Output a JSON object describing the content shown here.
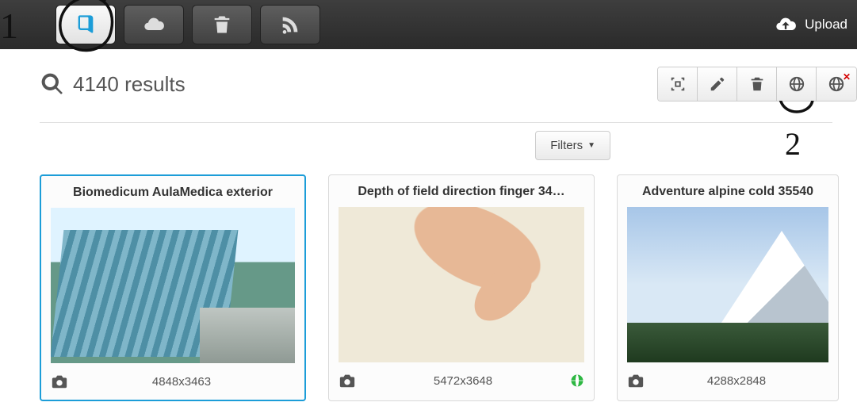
{
  "topbar": {
    "upload_label": "Upload"
  },
  "results": {
    "count_text": "4140 results"
  },
  "filters": {
    "label": "Filters"
  },
  "cards": [
    {
      "title": "Biomedicum AulaMedica exterior",
      "dims": "4848x3463",
      "public": false,
      "selected": true
    },
    {
      "title": "Depth of field direction finger 34…",
      "dims": "5472x3648",
      "public": true,
      "selected": false
    },
    {
      "title": "Adventure alpine cold 35540",
      "dims": "4288x2848",
      "public": false,
      "selected": false
    }
  ],
  "annotations": {
    "n1": "1",
    "n2": "2"
  }
}
